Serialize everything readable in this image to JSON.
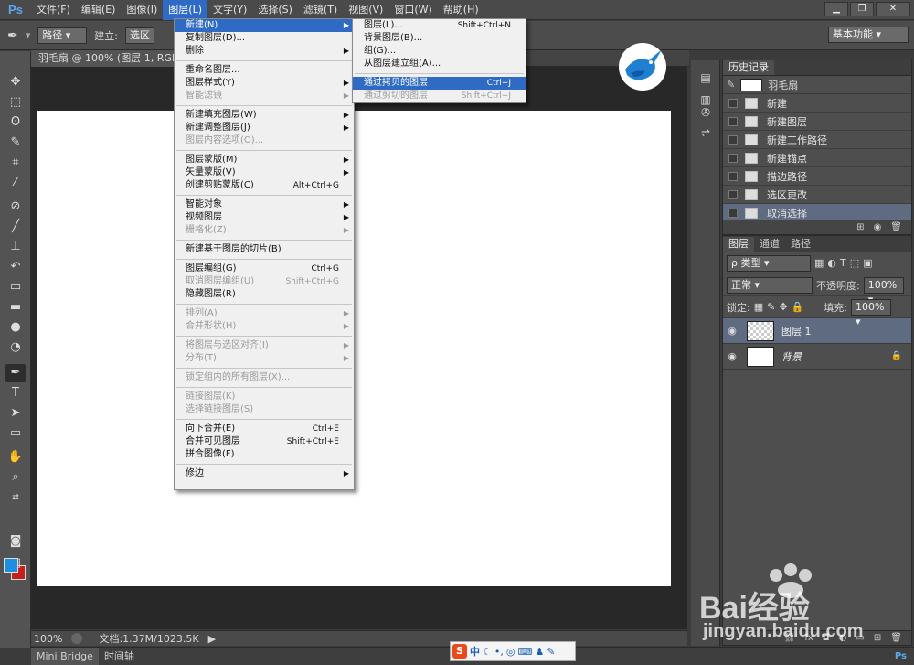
{
  "app": {
    "logo": "Ps"
  },
  "menubar": {
    "items": [
      "文件(F)",
      "编辑(E)",
      "图像(I)",
      "图层(L)",
      "文字(Y)",
      "选择(S)",
      "滤镜(T)",
      "视图(V)",
      "窗口(W)",
      "帮助(H)"
    ],
    "active_index": 3
  },
  "optionsbar": {
    "mode_value": "路径",
    "make_label": "建立:",
    "selection_label": "选区",
    "workspace": "基本功能"
  },
  "document": {
    "tab_title": "羽毛扇 @ 100% (图层 1, RGB",
    "zoom": "100%",
    "doc_info": "文档:1.37M/1023.5K"
  },
  "bottom_tabs": [
    "Mini Bridge",
    "时间轴"
  ],
  "layer_menu": {
    "groups": [
      [
        {
          "label": "新建(N)",
          "arrow": true,
          "highlighted": true
        },
        {
          "label": "复制图层(D)..."
        },
        {
          "label": "删除",
          "arrow": true
        }
      ],
      [
        {
          "label": "重命名图层..."
        },
        {
          "label": "图层样式(Y)",
          "arrow": true
        },
        {
          "label": "智能滤镜",
          "disabled": true,
          "arrow": true
        }
      ],
      [
        {
          "label": "新建填充图层(W)",
          "arrow": true
        },
        {
          "label": "新建调整图层(J)",
          "arrow": true
        },
        {
          "label": "图层内容选项(O)...",
          "disabled": true
        }
      ],
      [
        {
          "label": "图层蒙版(M)",
          "arrow": true
        },
        {
          "label": "矢量蒙版(V)",
          "arrow": true
        },
        {
          "label": "创建剪贴蒙版(C)",
          "shortcut": "Alt+Ctrl+G"
        }
      ],
      [
        {
          "label": "智能对象",
          "arrow": true
        },
        {
          "label": "视频图层",
          "arrow": true
        },
        {
          "label": "栅格化(Z)",
          "disabled": true,
          "arrow": true
        }
      ],
      [
        {
          "label": "新建基于图层的切片(B)"
        }
      ],
      [
        {
          "label": "图层编组(G)",
          "shortcut": "Ctrl+G"
        },
        {
          "label": "取消图层编组(U)",
          "shortcut": "Shift+Ctrl+G",
          "disabled": true
        },
        {
          "label": "隐藏图层(R)"
        }
      ],
      [
        {
          "label": "排列(A)",
          "disabled": true,
          "arrow": true
        },
        {
          "label": "合并形状(H)",
          "disabled": true,
          "arrow": true
        }
      ],
      [
        {
          "label": "将图层与选区对齐(I)",
          "disabled": true,
          "arrow": true
        },
        {
          "label": "分布(T)",
          "disabled": true,
          "arrow": true
        }
      ],
      [
        {
          "label": "锁定组内的所有图层(X)...",
          "disabled": true
        }
      ],
      [
        {
          "label": "链接图层(K)",
          "disabled": true
        },
        {
          "label": "选择链接图层(S)",
          "disabled": true
        }
      ],
      [
        {
          "label": "向下合并(E)",
          "shortcut": "Ctrl+E"
        },
        {
          "label": "合并可见图层",
          "shortcut": "Shift+Ctrl+E"
        },
        {
          "label": "拼合图像(F)"
        }
      ],
      [
        {
          "label": "修边",
          "arrow": true
        }
      ]
    ]
  },
  "new_submenu": {
    "groups": [
      [
        {
          "label": "图层(L)...",
          "shortcut": "Shift+Ctrl+N"
        },
        {
          "label": "背景图层(B)..."
        },
        {
          "label": "组(G)..."
        },
        {
          "label": "从图层建立组(A)..."
        }
      ],
      [
        {
          "label": "通过拷贝的图层",
          "shortcut": "Ctrl+J",
          "highlighted": true
        },
        {
          "label": "通过剪切的图层",
          "shortcut": "Shift+Ctrl+J",
          "disabled": true
        }
      ]
    ]
  },
  "history": {
    "tab": "历史记录",
    "snapshot": "羽毛扇",
    "items": [
      {
        "label": "新建"
      },
      {
        "label": "新建图层"
      },
      {
        "label": "新建工作路径"
      },
      {
        "label": "新建锚点"
      },
      {
        "label": "描边路径"
      },
      {
        "label": "选区更改"
      },
      {
        "label": "取消选择",
        "selected": true
      }
    ]
  },
  "layers": {
    "tabs": [
      "图层",
      "通道",
      "路径"
    ],
    "filter": "ρ 类型",
    "blend_mode": "正常",
    "opacity_label": "不透明度:",
    "opacity": "100%",
    "lock_label": "锁定:",
    "fill_label": "填充:",
    "fill": "100%",
    "items": [
      {
        "name": "图层 1",
        "selected": true,
        "transparent": true
      },
      {
        "name": "背景",
        "locked": true
      }
    ]
  },
  "watermark": {
    "text": "Bai经验",
    "url": "jingyan.baidu.com"
  },
  "ime": {
    "mode": "中"
  },
  "colors": {
    "foreground": "#1d8fe0",
    "background": "#c4201c",
    "highlight": "#2f6bc4"
  }
}
